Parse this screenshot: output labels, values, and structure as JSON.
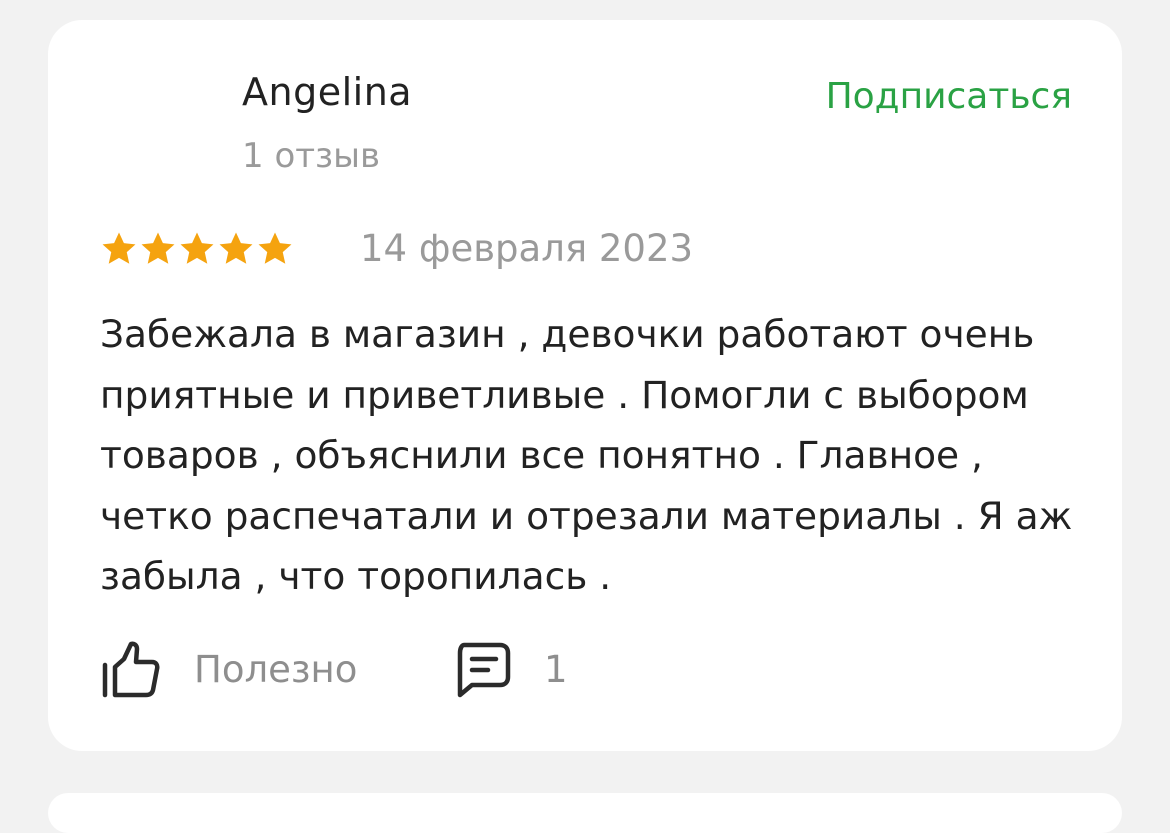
{
  "review": {
    "author": "Angelina",
    "review_count": "1 отзыв",
    "subscribe_label": "Подписаться",
    "rating": 5,
    "rating_max": 5,
    "date": "14 февраля 2023",
    "text": "Забежала в магазин , девочки работают очень приятные и приветливые . Помогли с выбором товаров , объяснили все понятно . Главное , четко распечатали и отрезали материалы . Я аж забыла , что торопилась .",
    "helpful_label": "Полезно",
    "comments_count": "1"
  },
  "colors": {
    "accent_green": "#2aa244",
    "star_gold": "#f5a30f",
    "muted_text": "#9a9a9a",
    "primary_text": "#222222"
  },
  "icons": {
    "star": "star-icon",
    "helpful": "thumbs-up-icon",
    "comments": "comment-icon"
  }
}
